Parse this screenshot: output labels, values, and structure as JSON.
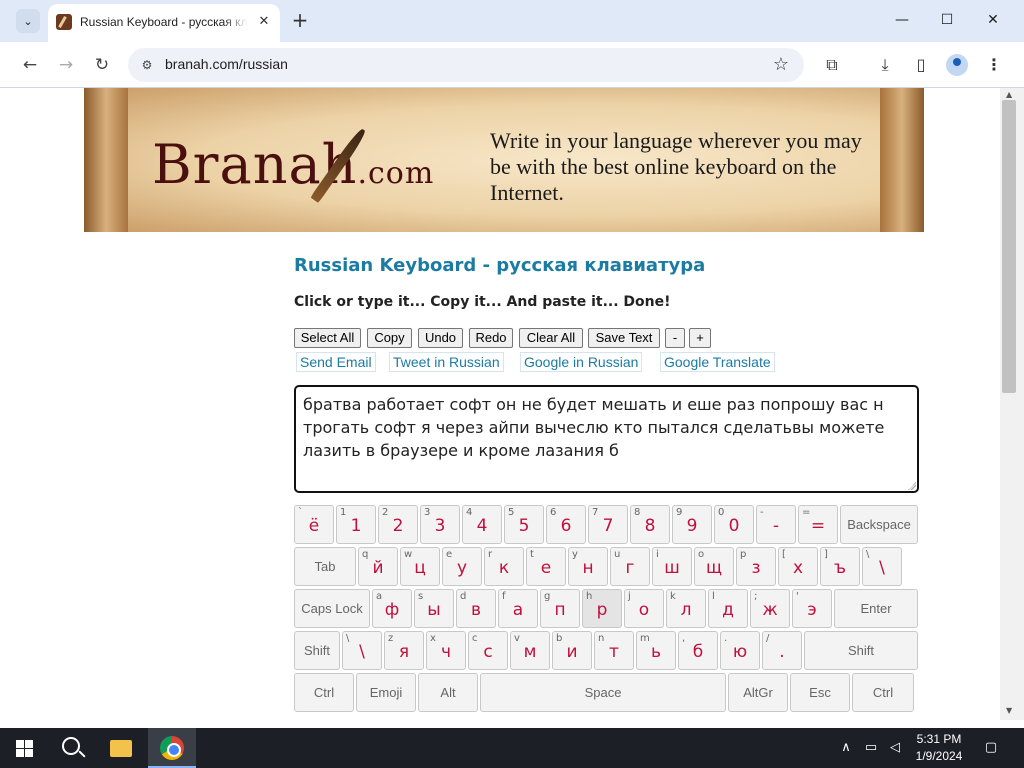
{
  "browser": {
    "tab_title": "Russian Keyboard - русская клавиатура",
    "tab_close": "✕",
    "new_tab": "+",
    "url": "branah.com/russian",
    "window_min": "—",
    "window_max": "☐",
    "window_close": "✕"
  },
  "banner": {
    "logo_main": "Branah",
    "logo_suffix": ".com",
    "tagline": "Write in your language wherever you may be with the best online keyboard on the Internet."
  },
  "page": {
    "title": "Russian Keyboard - русская клавиатура",
    "subtitle": "Click or type it... Copy it... And paste it... Done!"
  },
  "buttons": [
    "Select All",
    "Copy",
    "Undo",
    "Redo",
    "Clear All",
    "Save Text",
    "-",
    "+"
  ],
  "links": [
    "Send Email",
    "Tweet in Russian",
    "Google in Russian",
    "Google Translate"
  ],
  "editor": {
    "text": "братва  работает софт он не будет мешать и еше раз попрошу вас н трогать софт я через айпи вычеслю кто пытался сделатьвы можете лазить в браузере и кроме лазания  б"
  },
  "keyboard": {
    "rows": [
      [
        [
          "`",
          "ё"
        ],
        [
          "1",
          "1"
        ],
        [
          "2",
          "2"
        ],
        [
          "3",
          "3"
        ],
        [
          "4",
          "4"
        ],
        [
          "5",
          "5"
        ],
        [
          "6",
          "6"
        ],
        [
          "7",
          "7"
        ],
        [
          "8",
          "8"
        ],
        [
          "9",
          "9"
        ],
        [
          "0",
          "0"
        ],
        [
          "-",
          "-"
        ],
        [
          "=",
          "="
        ],
        [
          "",
          "Backspace"
        ]
      ],
      [
        [
          "",
          "Tab"
        ],
        [
          "q",
          "й"
        ],
        [
          "w",
          "ц"
        ],
        [
          "e",
          "у"
        ],
        [
          "r",
          "к"
        ],
        [
          "t",
          "е"
        ],
        [
          "y",
          "н"
        ],
        [
          "u",
          "г"
        ],
        [
          "i",
          "ш"
        ],
        [
          "o",
          "щ"
        ],
        [
          "p",
          "з"
        ],
        [
          "[",
          "х"
        ],
        [
          "]",
          "ъ"
        ],
        [
          "\\",
          "\\"
        ]
      ],
      [
        [
          "",
          "Caps Lock"
        ],
        [
          "a",
          "ф"
        ],
        [
          "s",
          "ы"
        ],
        [
          "d",
          "в"
        ],
        [
          "f",
          "а"
        ],
        [
          "g",
          "п"
        ],
        [
          "h",
          "р"
        ],
        [
          "j",
          "о"
        ],
        [
          "k",
          "л"
        ],
        [
          "l",
          "д"
        ],
        [
          ";",
          "ж"
        ],
        [
          "'",
          "э"
        ],
        [
          "",
          "Enter"
        ]
      ],
      [
        [
          "",
          "Shift"
        ],
        [
          "\\",
          "\\"
        ],
        [
          "z",
          "я"
        ],
        [
          "x",
          "ч"
        ],
        [
          "c",
          "с"
        ],
        [
          "v",
          "м"
        ],
        [
          "b",
          "и"
        ],
        [
          "n",
          "т"
        ],
        [
          "m",
          "ь"
        ],
        [
          ",",
          "б"
        ],
        [
          ".",
          "ю"
        ],
        [
          "/",
          "."
        ],
        [
          "",
          "Shift"
        ]
      ],
      [
        [
          "",
          "Ctrl"
        ],
        [
          "",
          "Emoji"
        ],
        [
          "",
          "Alt"
        ],
        [
          "",
          "Space"
        ],
        [
          "",
          "AltGr"
        ],
        [
          "",
          "Esc"
        ],
        [
          "",
          "Ctrl"
        ]
      ]
    ]
  },
  "taskbar": {
    "time": "5:31 PM",
    "date": "1/9/2024"
  },
  "icons": {
    "tab_search": "chevron-down-icon",
    "back": "arrow-left-icon",
    "forward": "arrow-right-icon",
    "reload": "reload-icon",
    "site_info": "tune-icon",
    "star": "star-icon",
    "extensions": "puzzle-icon",
    "download": "download-icon",
    "side_panel": "side-panel-icon",
    "profile": "profile-icon",
    "menu": "kebab-menu-icon"
  }
}
